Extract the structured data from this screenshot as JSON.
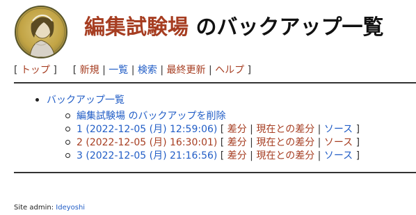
{
  "header": {
    "page_name": "編集試験場",
    "title_suffix": " のバックアップ一覧"
  },
  "nav": {
    "open": "[",
    "close": "]",
    "sep": "|",
    "top": "トップ",
    "new": "新規",
    "list": "一覧",
    "search": "検索",
    "recent": "最終更新",
    "help": "ヘルプ"
  },
  "backups": {
    "heading": "バックアップ一覧",
    "delete_label": "編集試験場 のバックアップを削除",
    "diff_label": "差分",
    "nowdiff_label": "現在との差分",
    "source_label": "ソース",
    "items": [
      {
        "label": "1 (2022-12-05 (月) 12:59:06)"
      },
      {
        "label": "2 (2022-12-05 (月) 16:30:01)"
      },
      {
        "label": "3 (2022-12-05 (月) 21:16:56)"
      }
    ]
  },
  "footer": {
    "prefix": "Site admin: ",
    "admin": "Ideyoshi"
  },
  "colors": {
    "link": "#215dc6",
    "visited": "#a63d21",
    "text": "#222222"
  }
}
